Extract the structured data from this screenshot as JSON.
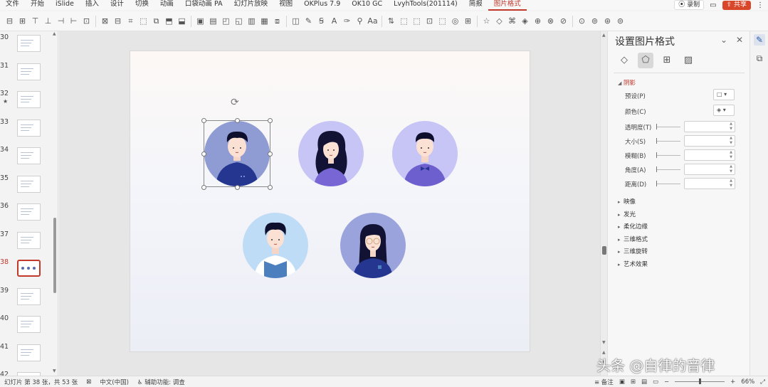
{
  "menubar": {
    "items": [
      "文件",
      "开始",
      "iSlide",
      "插入",
      "设计",
      "切换",
      "动画",
      "口袋动画 PA",
      "幻灯片放映",
      "视图",
      "OKPlus 7.9",
      "OK10 GC",
      "LvyhTools(201114)",
      "简报",
      "图片格式"
    ],
    "active_index": 14,
    "record_label": "录制",
    "share_label": "共享"
  },
  "thumbnails": [
    {
      "num": "30",
      "active": false,
      "star": false
    },
    {
      "num": "31",
      "active": false,
      "star": false
    },
    {
      "num": "32",
      "active": false,
      "star": true
    },
    {
      "num": "33",
      "active": false,
      "star": false
    },
    {
      "num": "34",
      "active": false,
      "star": false
    },
    {
      "num": "35",
      "active": false,
      "star": false
    },
    {
      "num": "36",
      "active": false,
      "star": false
    },
    {
      "num": "37",
      "active": false,
      "star": false
    },
    {
      "num": "38",
      "active": true,
      "star": false
    },
    {
      "num": "39",
      "active": false,
      "star": false
    },
    {
      "num": "40",
      "active": false,
      "star": false
    },
    {
      "num": "41",
      "active": false,
      "star": false
    },
    {
      "num": "42",
      "active": false,
      "star": false
    }
  ],
  "pane": {
    "title": "设置图片格式",
    "shadow_section": "阴影",
    "props": {
      "preset": "预设(P)",
      "color": "颜色(C)",
      "transparency": "透明度(T)",
      "size": "大小(S)",
      "blur": "模糊(B)",
      "angle": "角度(A)",
      "distance": "距离(D)"
    },
    "sections": [
      "映像",
      "发光",
      "柔化边缘",
      "三维格式",
      "三维旋转",
      "艺术效果"
    ]
  },
  "status": {
    "slide_info": "幻灯片 第 38 张，共 53 张",
    "language": "中文(中国)",
    "accessibility": "辅助功能: 调查",
    "notes": "备注",
    "zoom": "66%"
  },
  "watermark": "头条 @自律的音律",
  "colors": {
    "accent": "#c0392b",
    "share": "#d9472b",
    "avatar_blue_bg": "#8f9cd4",
    "avatar_lavender_bg": "#c7c5f5",
    "avatar_light_blue_bg": "#bfdcf7",
    "avatar_periwinkle_bg": "#9ba3dc"
  }
}
